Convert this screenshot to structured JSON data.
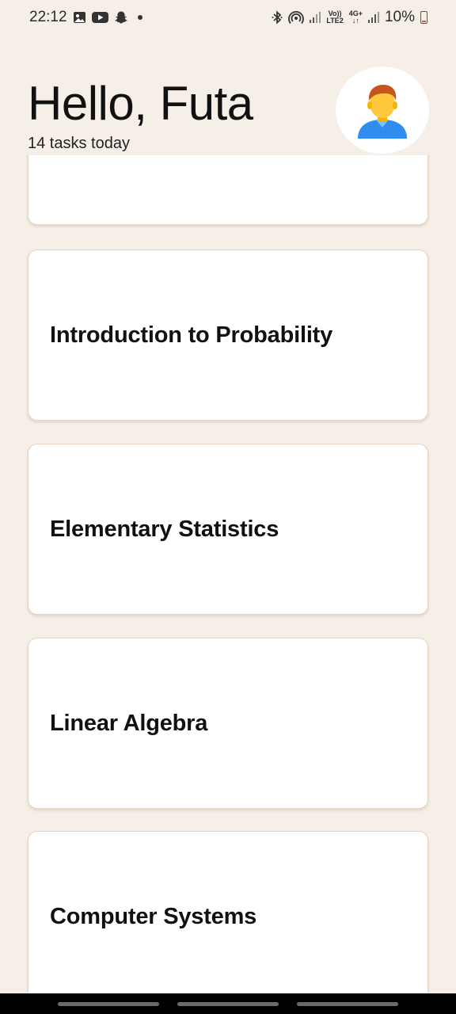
{
  "status_bar": {
    "time": "22:12",
    "left_icons": [
      "image-icon",
      "youtube-icon",
      "snapchat-icon",
      "dot-icon"
    ],
    "signal_label_top": "Vo))",
    "signal_label_bottom": "LTE2",
    "network_label": "4G+",
    "battery": "10%",
    "battery_color": "#e05a3a"
  },
  "header": {
    "greeting": "Hello, Futa",
    "subtitle": "14 tasks today",
    "avatar_icon": "user-avatar-icon"
  },
  "tasks": [
    {
      "title": ""
    },
    {
      "title": "Introduction to Probability"
    },
    {
      "title": "Elementary Statistics"
    },
    {
      "title": "Linear Algebra"
    },
    {
      "title": "Computer Systems"
    }
  ],
  "colors": {
    "background": "#f5efe8",
    "card": "#ffffff",
    "card_border": "#e6d4c4"
  }
}
